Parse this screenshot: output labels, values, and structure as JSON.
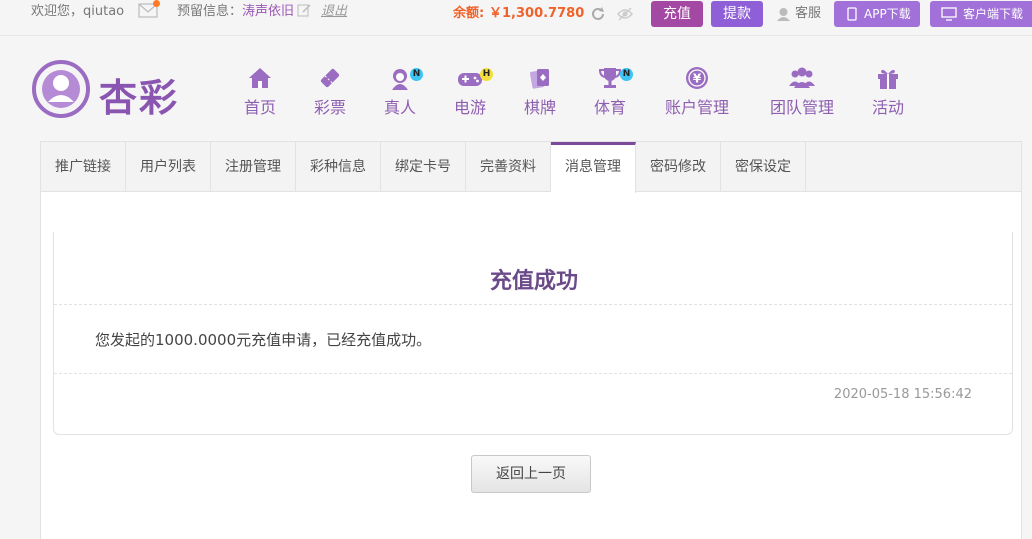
{
  "topbar": {
    "welcome": "欢迎您，qiutao",
    "notice_label": "预留信息：",
    "notice_value": "涛声依旧",
    "logout": "退出",
    "balance_label": "余额:",
    "balance_value": "￥1,300.7780",
    "recharge": "充值",
    "withdraw": "提款",
    "service": "客服",
    "app_download": "APP下载",
    "client_download": "客户端下载"
  },
  "logo": {
    "text": "杏彩"
  },
  "nav": [
    {
      "label": "首页",
      "icon": "home-icon"
    },
    {
      "label": "彩票",
      "icon": "lottery-icon"
    },
    {
      "label": "真人",
      "icon": "live-dealer-icon",
      "badge": "N"
    },
    {
      "label": "电游",
      "icon": "gamepad-icon",
      "badge": "H"
    },
    {
      "label": "棋牌",
      "icon": "cards-icon"
    },
    {
      "label": "体育",
      "icon": "trophy-icon",
      "badge": "N"
    },
    {
      "label": "账户管理",
      "icon": "yen-coin-icon"
    },
    {
      "label": "团队管理",
      "icon": "team-icon"
    },
    {
      "label": "活动",
      "icon": "gift-icon"
    }
  ],
  "tabs": [
    "推广链接",
    "用户列表",
    "注册管理",
    "彩种信息",
    "绑定卡号",
    "完善资料",
    "消息管理",
    "密码修改",
    "密保设定"
  ],
  "active_tab": "消息管理",
  "message": {
    "title": "充值成功",
    "body": "您发起的1000.0000元充值申请，已经充值成功。",
    "time": "2020-05-18 15:56:42"
  },
  "back_button": "返回上一页",
  "colors": {
    "brand": "#8e5fb0",
    "accent": "#f0622a",
    "recharge": "#a349a4",
    "withdraw": "#8e5fd6"
  }
}
